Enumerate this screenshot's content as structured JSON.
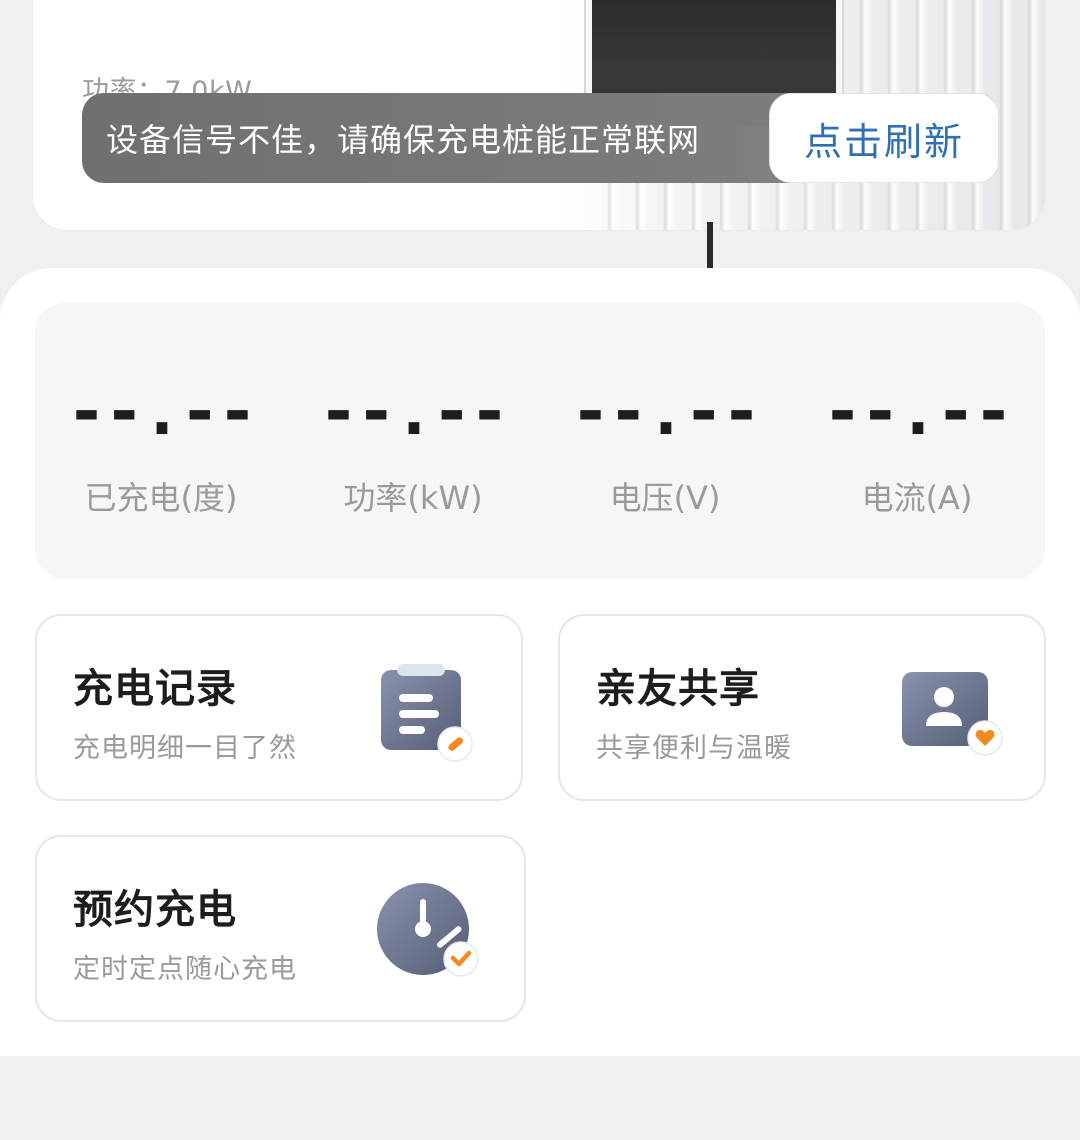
{
  "device": {
    "power_text": "功率：7.0kW"
  },
  "banner": {
    "message": "设备信号不佳，请确保充电桩能正常联网",
    "refresh_label": "点击刷新"
  },
  "stats": [
    {
      "value": "--.--",
      "label": "已充电(度)"
    },
    {
      "value": "--.--",
      "label": "功率(kW)"
    },
    {
      "value": "--.--",
      "label": "电压(V)"
    },
    {
      "value": "--.--",
      "label": "电流(A)"
    }
  ],
  "cards": {
    "records": {
      "title": "充电记录",
      "subtitle": "充电明细一目了然",
      "icon": "clipboard-edit-icon"
    },
    "share": {
      "title": "亲友共享",
      "subtitle": "共享便利与温暖",
      "icon": "user-heart-icon"
    },
    "schedule": {
      "title": "预约充电",
      "subtitle": "定时定点随心充电",
      "icon": "clock-check-icon"
    }
  },
  "colors": {
    "accent": "#2f6fb4",
    "badge_orange": "#f28a1e",
    "icon_slate": "#6b7490"
  }
}
